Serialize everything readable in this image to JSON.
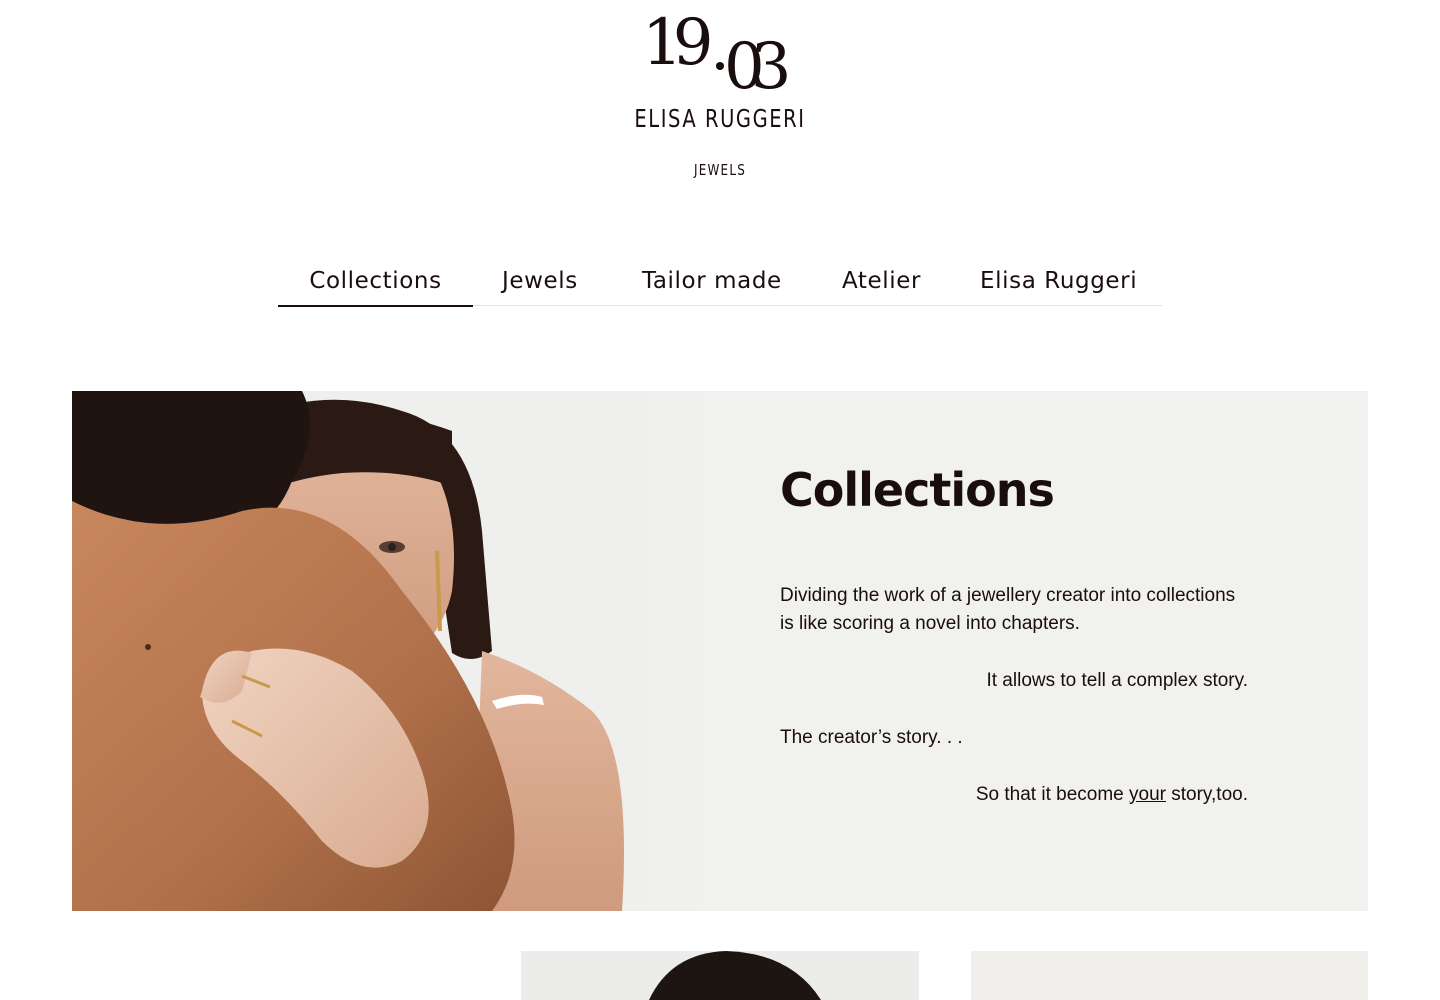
{
  "brand": {
    "logo_text": "19.03",
    "name": "ELISA RUGGERI",
    "subtitle": "JEWELS"
  },
  "nav": {
    "items": [
      {
        "label": "Collections",
        "active": true
      },
      {
        "label": "Jewels",
        "active": false
      },
      {
        "label": "Tailor made",
        "active": false
      },
      {
        "label": "Atelier",
        "active": false
      },
      {
        "label": "Elisa Ruggeri",
        "active": false
      }
    ]
  },
  "hero": {
    "title": "Collections",
    "paragraph_1": "Dividing the work of a jewellery creator into collections is like scoring a novel into chapters.",
    "paragraph_2": "It allows to tell a complex story.",
    "paragraph_3": "The creator’s story. . .",
    "paragraph_4_before": "So that it become ",
    "paragraph_4_emphasis": "your",
    "paragraph_4_after": " story,too."
  },
  "colors": {
    "text": "#1a0d0d",
    "hero_background": "#f1f1ef",
    "nav_divider": "#e2e2e2"
  }
}
